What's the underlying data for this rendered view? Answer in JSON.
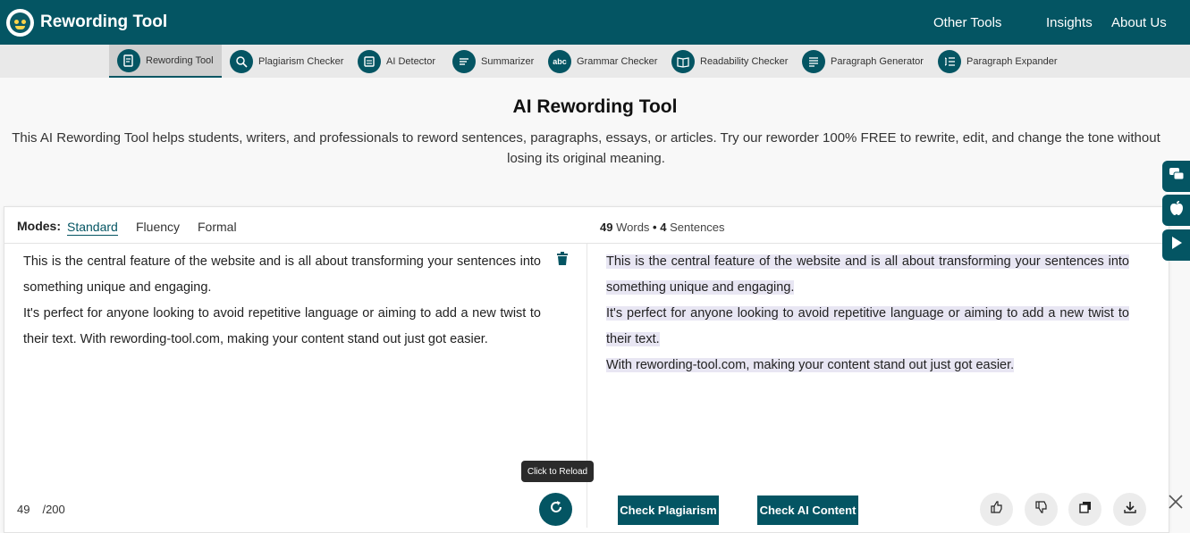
{
  "brand": {
    "name": "Rewording Tool"
  },
  "topnav": {
    "other_tools": "Other Tools",
    "insights": "Insights",
    "about_us": "About Us"
  },
  "tools": [
    {
      "label": "Rewording Tool",
      "icon": "rewording-icon",
      "active": true
    },
    {
      "label": "Plagiarism Checker",
      "icon": "plagiarism-icon"
    },
    {
      "label": "AI Detector",
      "icon": "ai-detector-icon"
    },
    {
      "label": "Summarizer",
      "icon": "summarizer-icon"
    },
    {
      "label": "Grammar Checker",
      "icon": "grammar-icon",
      "glyph": "abc"
    },
    {
      "label": "Readability Checker",
      "icon": "book-icon"
    },
    {
      "label": "Paragraph Generator",
      "icon": "paragraph-generator-icon"
    },
    {
      "label": "Paragraph Expander",
      "icon": "paragraph-expander-icon"
    }
  ],
  "hero": {
    "title": "AI Rewording Tool",
    "description": "This AI Rewording Tool helps students, writers, and professionals to reword sentences, paragraphs, essays, or articles. Try our reworder 100% FREE to rewrite, edit, and change the tone without losing its original meaning."
  },
  "modes": {
    "label": "Modes:",
    "items": [
      "Standard",
      "Fluency",
      "Formal"
    ],
    "selected": "Standard"
  },
  "stats": {
    "words": "49",
    "words_label": "Words",
    "separator": "•",
    "sentences": "4",
    "sentences_label": "Sentences"
  },
  "input": {
    "paragraphs": [
      "This is the central feature of the website and is all about transforming your sentences into something unique and engaging.",
      "It's perfect for anyone looking to avoid repetitive language or aiming to add a new twist to their text. With rewording-tool.com, making your content stand out just got easier."
    ],
    "count": "49",
    "limit": "/200"
  },
  "output": {
    "sentences": [
      "This is the central feature of the website and is all about transforming your sentences into something unique and engaging.",
      "It's perfect for anyone looking to avoid repetitive language or aiming to add a new twist to their text.",
      "With rewording-tool.com, making your content stand out just got easier."
    ]
  },
  "actions": {
    "reload_tooltip": "Click to Reload",
    "check_plagiarism": "Check Plagiarism",
    "check_ai": "Check AI Content"
  },
  "colors": {
    "brand": "#045563",
    "highlight": "#e8e6f3",
    "toolbar_bg": "#e9e9e9"
  }
}
